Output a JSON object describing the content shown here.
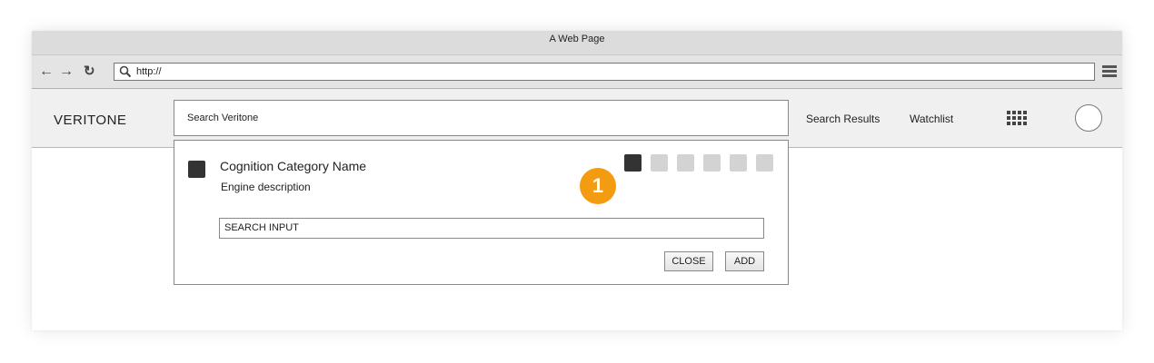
{
  "window": {
    "title": "A Web Page"
  },
  "browser": {
    "back_icon": "back-arrow-icon",
    "forward_icon": "forward-arrow-icon",
    "reload_icon": "reload-icon",
    "url": "http://",
    "menu_icon": "hamburger-menu-icon"
  },
  "app": {
    "brand": "VERITONE",
    "search_placeholder": "Search Veritone",
    "nav": [
      "Search Results",
      "Watchlist"
    ],
    "apps_icon": "apps-grid-icon",
    "avatar_icon": "user-avatar"
  },
  "panel": {
    "category_name": "Cognition Category Name",
    "engine_description": "Engine description",
    "annotation_badge": "1",
    "engine_selector": {
      "count": 6,
      "selected_index": 0
    },
    "search_input_value": "SEARCH INPUT",
    "close_label": "CLOSE",
    "add_label": "ADD"
  },
  "colors": {
    "badge": "#f39c12",
    "active_square": "#333333",
    "inactive_square": "#d3d3d3"
  }
}
